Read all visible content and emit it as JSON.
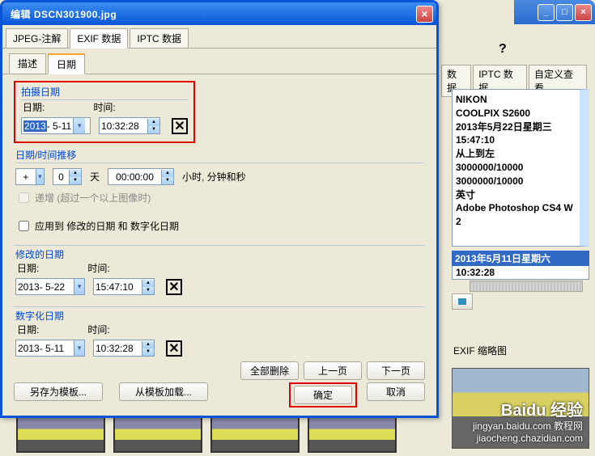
{
  "parent_title": "",
  "dialog": {
    "title": "编辑 DSCN301900.jpg",
    "tabs": {
      "t1": "JPEG-注解",
      "t2": "EXIF 数据",
      "t3": "IPTC 数据"
    },
    "subtabs": {
      "s1": "描述",
      "s2": "日期"
    }
  },
  "capture": {
    "legend": "拍摄日期",
    "date_lbl": "日期:",
    "time_lbl": "时间:",
    "date_sel": "2013",
    "date_rest": "- 5-11",
    "time": "10:32:28",
    "offset_hdr": "日期/时间推移",
    "plus": "+",
    "off_days": "0",
    "days_lbl": "天",
    "off_time": "00:00:00",
    "hms_lbl": "小时, 分钟和秒",
    "recur": "递增 (超过一个以上图像时)",
    "apply": "应用到 修改的日期 和 数字化日期"
  },
  "modified": {
    "legend": "修改的日期",
    "date_lbl": "日期:",
    "time_lbl": "时间:",
    "date": "2013- 5-22",
    "time": "15:47:10"
  },
  "digitized": {
    "legend": "数字化日期",
    "date_lbl": "日期:",
    "time_lbl": "时间:",
    "date": "2013- 5-11",
    "time": "10:32:28"
  },
  "btns": {
    "del_all": "全部删除",
    "prev": "上一页",
    "next": "下一页",
    "save_tpl": "另存为模板...",
    "load_tpl": "从模板加载...",
    "ok": "确定",
    "cancel": "取消"
  },
  "right": {
    "help": "?",
    "tab1": "数据",
    "tab2": "IPTC 数据",
    "tab3": "自定义查看",
    "exif": {
      "l1": "NIKON",
      "l2": "COOLPIX S2600",
      "l3": "2013年5月22日星期三",
      "l4": "15:47:10",
      "l5": "从上到左",
      "l6": "3000000/10000",
      "l7": "3000000/10000",
      "l8": "英寸",
      "l9": "Adobe Photoshop CS4 W",
      "l10": "2"
    },
    "sel1": "2013年5月11日星期六",
    "sel2": "10:32:28",
    "hist_lbl": "■",
    "thumb_title": "EXIF 缩略图"
  },
  "watermark": {
    "l1": "Baidu 经验",
    "l2": "jingyan.baidu.com 教程网",
    "l3": "jiaocheng.chazidian.com"
  }
}
